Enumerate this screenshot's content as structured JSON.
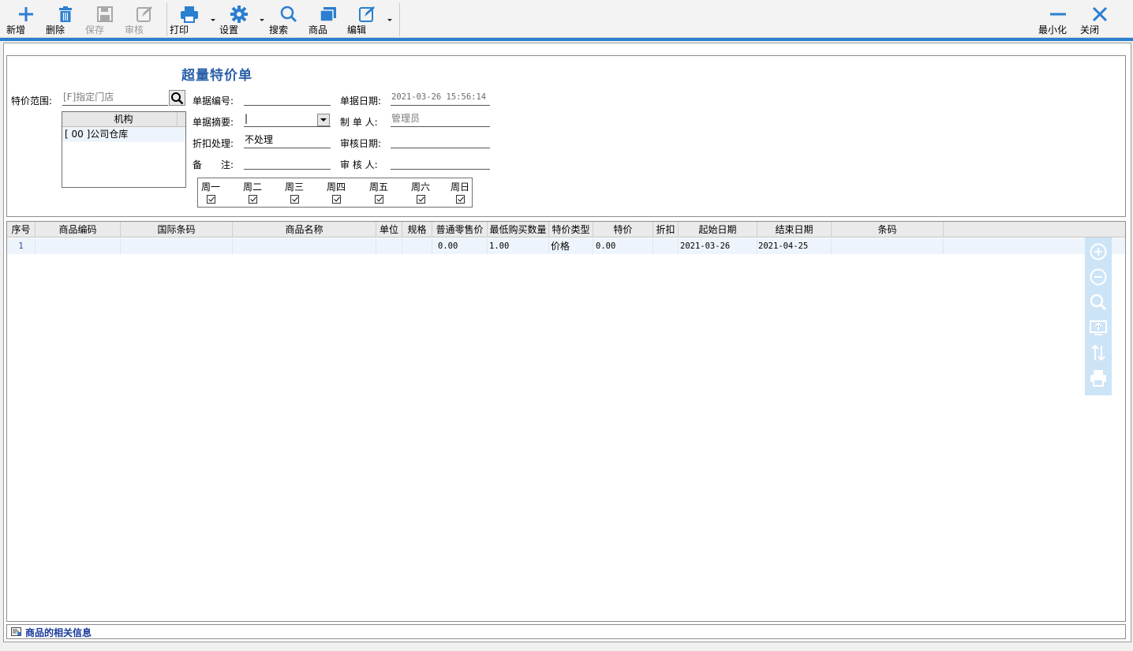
{
  "toolbar": {
    "new": "新增",
    "delete": "删除",
    "save": "保存",
    "audit": "审核",
    "print": "打印",
    "settings": "设置",
    "search": "搜索",
    "goods": "商品",
    "edit": "编辑",
    "minimize": "最小化",
    "close": "关闭"
  },
  "colors": {
    "accent": "#2b80d0",
    "title": "#2a5fa8",
    "selected_row": "#eef4fb"
  },
  "form": {
    "title": "超量特价单",
    "scope_label": "特价范围:",
    "scope_value": "[F]指定门店",
    "org_header": "机构",
    "org_items": [
      "[ 00 ]公司仓库"
    ],
    "doc_no_label": "单据编号:",
    "doc_no_value": "",
    "summary_label": "单据摘要:",
    "summary_value": "|",
    "discount_label": "折扣处理:",
    "discount_value": "不处理",
    "remark_label": "备　　注:",
    "remark_value": "",
    "date_label": "单据日期:",
    "date_value": "2021-03-26 15:56:14",
    "maker_label": "制 单 人:",
    "maker_value": "管理员",
    "audit_date_label": "审核日期:",
    "audit_date_value": "",
    "auditor_label": "审 核 人:",
    "auditor_value": "",
    "weekdays": [
      {
        "label": "周一",
        "checked": true
      },
      {
        "label": "周二",
        "checked": true
      },
      {
        "label": "周三",
        "checked": true
      },
      {
        "label": "周四",
        "checked": true
      },
      {
        "label": "周五",
        "checked": true
      },
      {
        "label": "周六",
        "checked": true
      },
      {
        "label": "周日",
        "checked": true
      }
    ]
  },
  "grid": {
    "columns": [
      "序号",
      "商品编码",
      "国际条码",
      "商品名称",
      "单位",
      "规格",
      "普通零售价",
      "最低购买数量",
      "特价类型",
      "特价",
      "折扣",
      "起始日期",
      "结束日期",
      "条码"
    ],
    "rows": [
      {
        "index": "1",
        "code": "",
        "barcode_intl": "",
        "name": "",
        "unit": "",
        "spec": "",
        "retail_price": "0.00",
        "min_qty": "1.00",
        "price_type": "价格",
        "special_price": "0.00",
        "discount": "",
        "start_date": "2021-03-26",
        "end_date": "2021-04-25",
        "barcode": ""
      }
    ]
  },
  "side_tools": [
    "add-circle-icon",
    "remove-circle-icon",
    "zoom-icon",
    "screen-icon",
    "sort-icon",
    "printer-icon"
  ],
  "footer": {
    "info": "商品的相关信息"
  }
}
